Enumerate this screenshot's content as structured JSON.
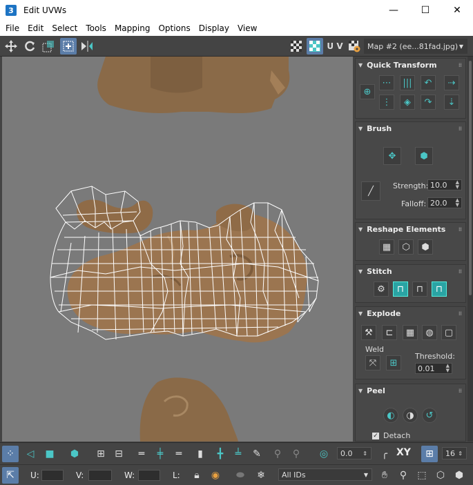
{
  "window": {
    "app_icon_text": "3",
    "title": "Edit UVWs",
    "minimize_glyph": "—",
    "maximize_glyph": "☐",
    "close_glyph": "✕"
  },
  "menu": [
    "File",
    "Edit",
    "Select",
    "Tools",
    "Mapping",
    "Options",
    "Display",
    "View"
  ],
  "toolbar": {
    "uv_label": "U V",
    "map_select_value": "Map #2 (ee...81fad.jpg)"
  },
  "panel": {
    "quick_transform": {
      "title": "Quick Transform"
    },
    "brush": {
      "title": "Brush",
      "strength_label": "Strength:",
      "strength_value": "10.0",
      "falloff_label": "Falloff:",
      "falloff_value": "20.0"
    },
    "reshape": {
      "title": "Reshape Elements"
    },
    "stitch": {
      "title": "Stitch"
    },
    "explode": {
      "title": "Explode",
      "weld_label": "Weld",
      "threshold_label": "Threshold:",
      "threshold_value": "0.01"
    },
    "peel": {
      "title": "Peel",
      "detach_label": "Detach",
      "detach_checked": true
    }
  },
  "bottom": {
    "rotation_value": "0.0",
    "xy_label": "XY",
    "grid_value": "16",
    "u_label": "U:",
    "v_label": "V:",
    "w_label": "W:",
    "l_label": "L:",
    "ids_select_value": "All IDs"
  },
  "colors": {
    "accent_teal": "#4bc6c6",
    "active_blue": "#5b7da8",
    "viewport_gray": "#7a7a7a",
    "cookie_brown": "#9b7550"
  }
}
